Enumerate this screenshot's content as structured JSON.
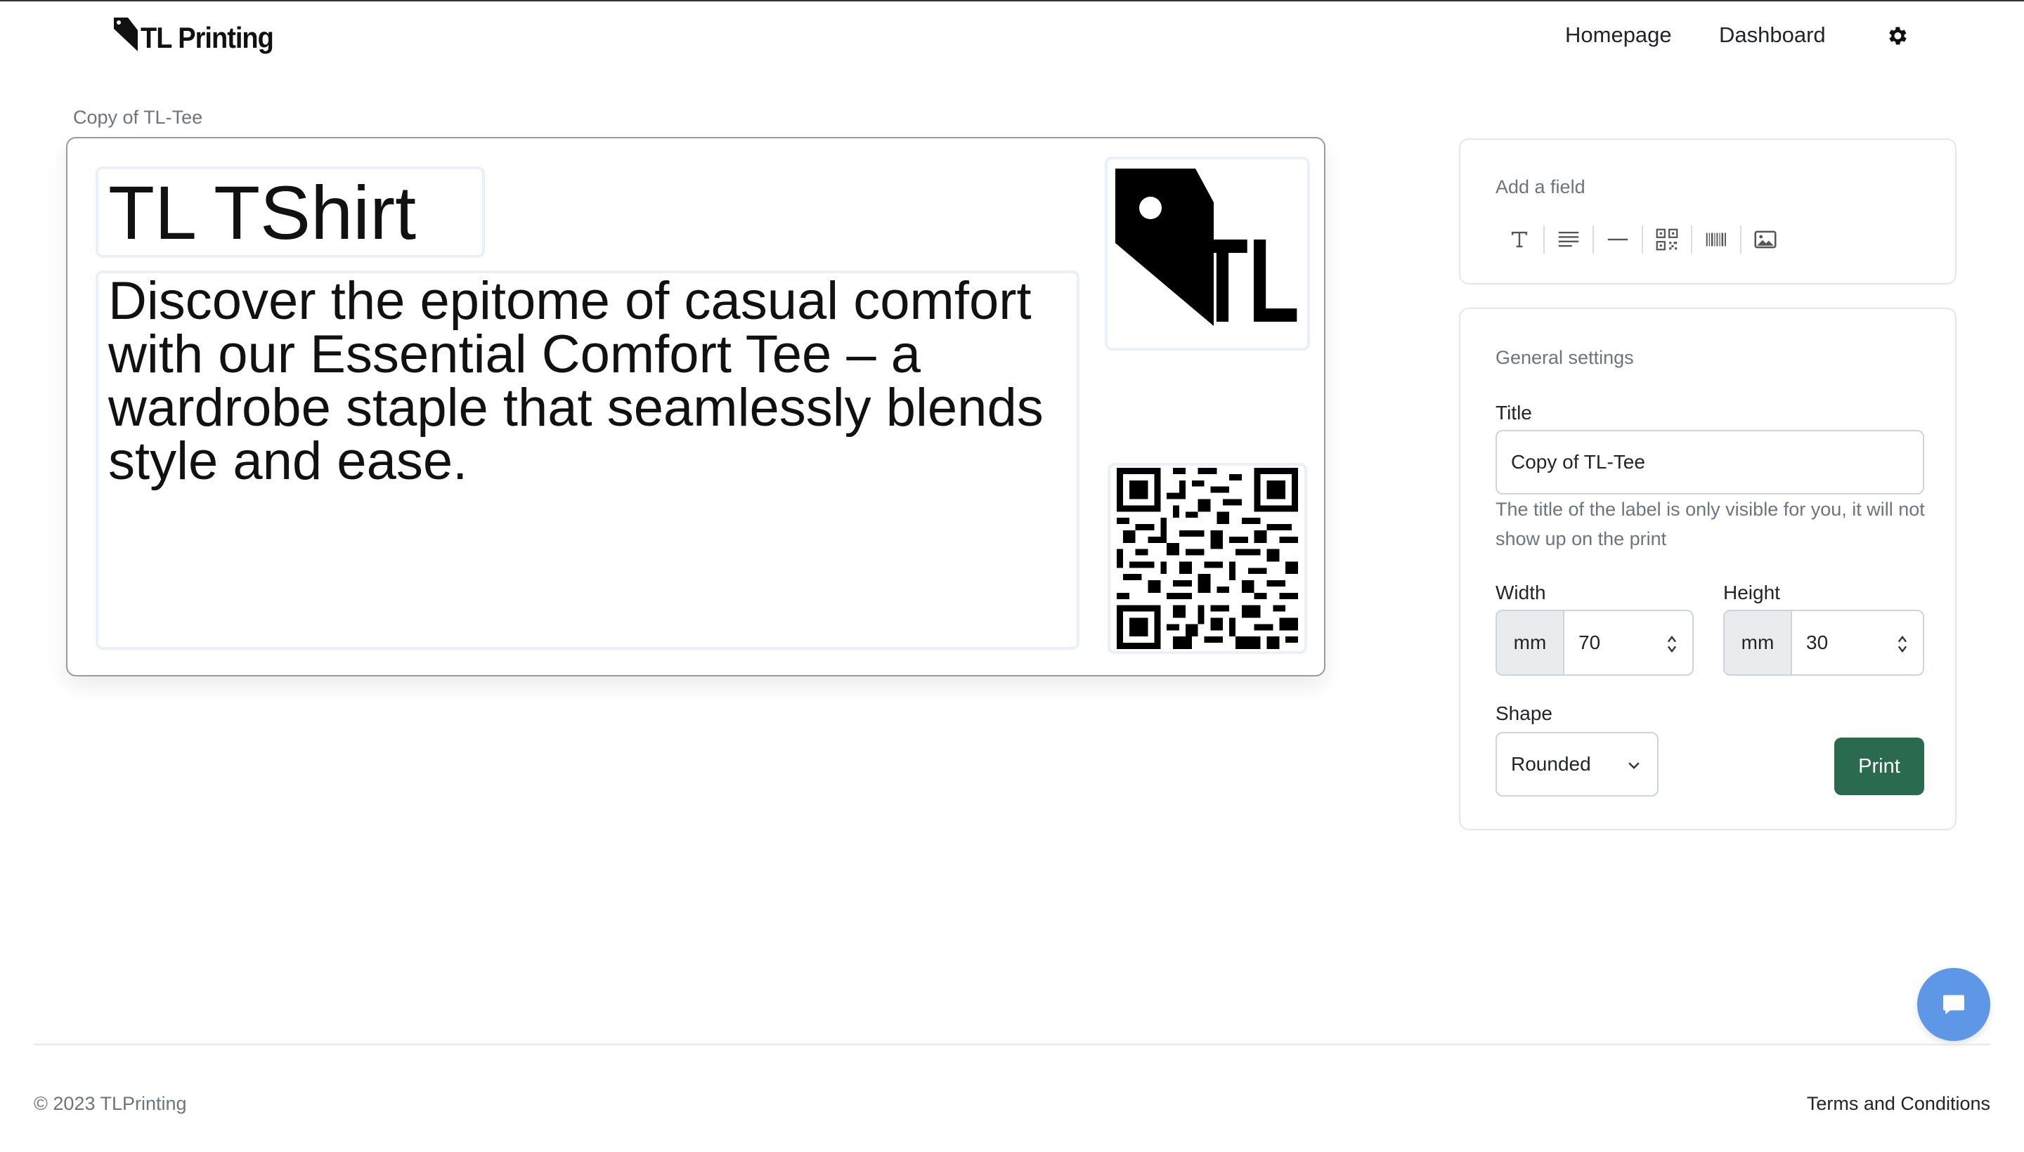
{
  "brand": {
    "name": "TL Printing"
  },
  "nav": {
    "homepage": "Homepage",
    "dashboard": "Dashboard",
    "settings_icon": "gear-icon"
  },
  "label": {
    "caption": "Copy of TL-Tee",
    "title_text": "TL TShirt",
    "description_text": "Discover the epitome of casual comfort with our Essential Comfort Tee – a wardrobe staple that seamlessly blends style and ease.",
    "logo_text": "TL",
    "logo_icon": "tag-logo-icon",
    "qr_icon": "qr-code-icon"
  },
  "add_field": {
    "heading": "Add a field",
    "tools": [
      "text-icon",
      "paragraph-icon",
      "divider-icon",
      "qr-code-icon",
      "barcode-icon",
      "image-icon"
    ]
  },
  "settings": {
    "heading": "General settings",
    "title_label": "Title",
    "title_value": "Copy of TL-Tee",
    "title_help": "The title of the label is only visible for you, it will not show up on the print",
    "width_label": "Width",
    "width_unit": "mm",
    "width_value": "70",
    "height_label": "Height",
    "height_unit": "mm",
    "height_value": "30",
    "shape_label": "Shape",
    "shape_value": "Rounded",
    "print_label": "Print"
  },
  "footer": {
    "copyright": "© 2023 TLPrinting",
    "terms": "Terms and Conditions"
  },
  "colors": {
    "primary": "#2a6b4f",
    "chat": "#5d97e6",
    "muted": "#6c757d"
  }
}
